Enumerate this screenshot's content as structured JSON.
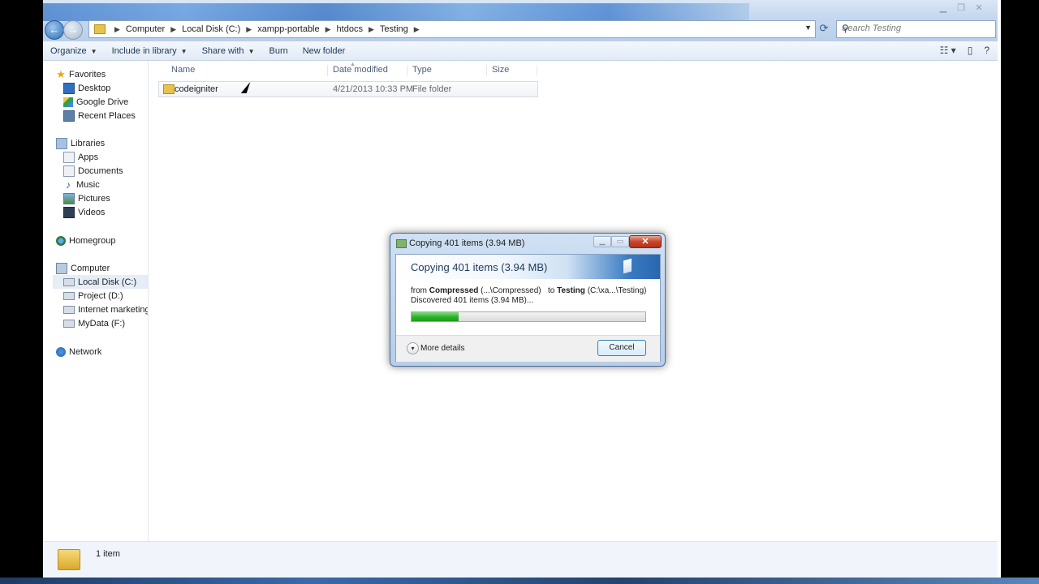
{
  "address_bar": {
    "crumbs": [
      "Computer",
      "Local Disk (C:)",
      "xampp-portable",
      "htdocs",
      "Testing"
    ]
  },
  "search": {
    "placeholder": "Search Testing"
  },
  "command_bar": {
    "organize": "Organize",
    "include_in_library": "Include in library",
    "share_with": "Share with",
    "burn": "Burn",
    "new_folder": "New folder"
  },
  "nav_pane": {
    "favorites": "Favorites",
    "favorites_items": [
      "Desktop",
      "Google Drive",
      "Recent Places"
    ],
    "libraries": "Libraries",
    "libraries_items": [
      "Apps",
      "Documents",
      "Music",
      "Pictures",
      "Videos"
    ],
    "homegroup": "Homegroup",
    "computer": "Computer",
    "computer_items": [
      "Local Disk (C:)",
      "Project (D:)",
      "Internet marketing (",
      "MyData (F:)"
    ],
    "network": "Network"
  },
  "columns": {
    "name": "Name",
    "date_modified": "Date modified",
    "type": "Type",
    "size": "Size"
  },
  "files": [
    {
      "name": "codeigniter",
      "date": "4/21/2013 10:33 PM",
      "type": "File folder"
    }
  ],
  "status": {
    "count": "1 item"
  },
  "copy_dialog": {
    "title": "Copying 401 items (3.94 MB)",
    "heading": "Copying 401 items (3.94 MB)",
    "from_label": "from",
    "from_name": "Compressed",
    "from_path": "(...\\Compressed)",
    "to_label": "to",
    "to_name": "Testing",
    "to_path": "(C:\\xa...\\Testing)",
    "discovered": "Discovered 401 items (3.94 MB)...",
    "progress_fraction": 0.2,
    "more_details": "More details",
    "cancel": "Cancel"
  }
}
